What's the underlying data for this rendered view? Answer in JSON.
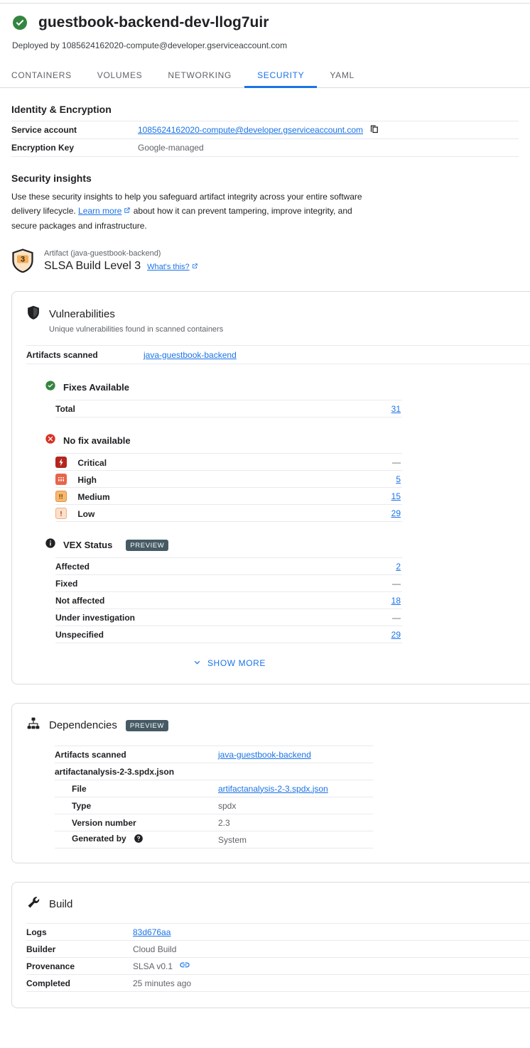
{
  "header": {
    "status_icon": "check-circle-icon",
    "title": "guestbook-backend-dev-llog7uir",
    "subtitle": "Deployed by 1085624162020-compute@developer.gserviceaccount.com"
  },
  "tabs": [
    {
      "label": "CONTAINERS",
      "active": false
    },
    {
      "label": "VOLUMES",
      "active": false
    },
    {
      "label": "NETWORKING",
      "active": false
    },
    {
      "label": "SECURITY",
      "active": true
    },
    {
      "label": "YAML",
      "active": false
    }
  ],
  "identity": {
    "heading": "Identity & Encryption",
    "rows": [
      {
        "key": "Service account",
        "value": "1085624162020-compute@developer.gserviceaccount.com",
        "is_link": true,
        "copy_icon": "copy-icon"
      },
      {
        "key": "Encryption Key",
        "value": "Google-managed",
        "is_link": false
      }
    ]
  },
  "security_insights": {
    "heading": "Security insights",
    "body_part1": "Use these security insights to help you safeguard artifact integrity across your entire software delivery lifecycle. ",
    "learn_more": "Learn more",
    "body_part2": " about how it can prevent tampering, improve integrity, and secure packages and infrastructure.",
    "slsa": {
      "badge_level": "3",
      "artifact_label": "Artifact (java-guestbook-backend)",
      "level_label": "SLSA Build Level 3",
      "whats_this": "What's this?"
    }
  },
  "vulnerabilities": {
    "icon": "shield-icon",
    "title": "Vulnerabilities",
    "subtitle": "Unique vulnerabilities found in scanned containers",
    "scanned_label": "Artifacts scanned",
    "scanned_value": "java-guestbook-backend",
    "fixes_available": {
      "icon": "check-circle-icon",
      "title": "Fixes Available",
      "rows": [
        {
          "label": "Total",
          "value": "31",
          "is_link": true
        }
      ]
    },
    "no_fix": {
      "icon": "error-circle-icon",
      "title": "No fix available",
      "rows": [
        {
          "icon": "severity-critical-icon",
          "label": "Critical",
          "value": "—",
          "is_link": false
        },
        {
          "icon": "severity-high-icon",
          "label": "High",
          "value": "5",
          "is_link": true
        },
        {
          "icon": "severity-medium-icon",
          "label": "Medium",
          "value": "15",
          "is_link": true
        },
        {
          "icon": "severity-low-icon",
          "label": "Low",
          "value": "29",
          "is_link": true
        }
      ]
    },
    "vex": {
      "icon": "info-icon",
      "title": "VEX Status",
      "badge": "PREVIEW",
      "rows": [
        {
          "label": "Affected",
          "value": "2",
          "is_link": true
        },
        {
          "label": "Fixed",
          "value": "—",
          "is_link": false
        },
        {
          "label": "Not affected",
          "value": "18",
          "is_link": true
        },
        {
          "label": "Under investigation",
          "value": "—",
          "is_link": false
        },
        {
          "label": "Unspecified",
          "value": "29",
          "is_link": true
        }
      ]
    },
    "show_more": "SHOW MORE"
  },
  "dependencies": {
    "icon": "dependencies-icon",
    "title": "Dependencies",
    "badge": "PREVIEW",
    "rows": [
      {
        "label": "Artifacts scanned",
        "value": "java-guestbook-backend",
        "is_link": true,
        "indent": false,
        "bold_value": false
      },
      {
        "label": "artifactanalysis-2-3.spdx.json",
        "value": "",
        "is_link": false,
        "indent": false,
        "bold_value": false
      },
      {
        "label": "File",
        "value": "artifactanalysis-2-3.spdx.json",
        "is_link": true,
        "indent": true,
        "bold_value": false
      },
      {
        "label": "Type",
        "value": "spdx",
        "is_link": false,
        "indent": true,
        "bold_value": false
      },
      {
        "label": "Version number",
        "value": "2.3",
        "is_link": false,
        "indent": true,
        "bold_value": false
      },
      {
        "label": "Generated by",
        "value": "System",
        "is_link": false,
        "indent": true,
        "help_icon": "help-icon"
      }
    ]
  },
  "build": {
    "icon": "wrench-icon",
    "title": "Build",
    "rows": [
      {
        "label": "Logs",
        "value": "83d676aa",
        "is_link": true
      },
      {
        "label": "Builder",
        "value": "Cloud Build",
        "is_link": false
      },
      {
        "label": "Provenance",
        "value": "SLSA v0.1",
        "is_link": false,
        "trailing_icon": "link-chip-icon"
      },
      {
        "label": "Completed",
        "value": "25 minutes ago",
        "is_link": false
      }
    ]
  },
  "colors": {
    "accent": "#1a73e8",
    "success": "#34a853",
    "error": "#d93025",
    "preview_badge": "#455a64",
    "severity_critical": "#b3261e",
    "severity_high": "#e8654a",
    "severity_medium": "#f5b971",
    "severity_low": "#fbe0cd",
    "slsa_badge": "#f2ae5c"
  }
}
